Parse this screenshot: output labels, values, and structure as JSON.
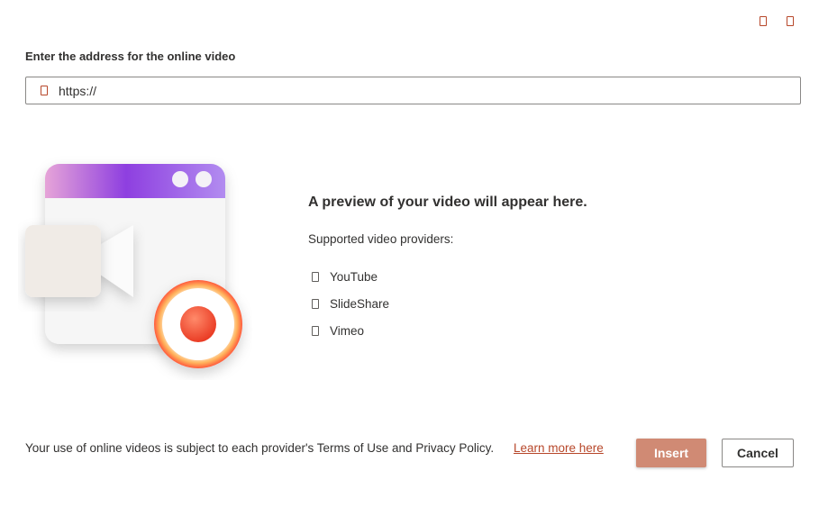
{
  "colors": {
    "accent": "#b7472a",
    "insert_bg": "#d08a74"
  },
  "top_icons": [
    {
      "name": "maximize-icon"
    },
    {
      "name": "close-icon"
    }
  ],
  "url_section": {
    "title": "Enter the address for the online video",
    "icon": "link-icon",
    "value": "https://"
  },
  "preview": {
    "title": "A preview of your video will appear here.",
    "providers_label": "Supported video providers:",
    "providers": [
      {
        "label": "YouTube",
        "icon": "youtube-icon"
      },
      {
        "label": "SlideShare",
        "icon": "slideshare-icon"
      },
      {
        "label": "Vimeo",
        "icon": "vimeo-icon"
      }
    ]
  },
  "footer": {
    "terms_text": "Your use of online videos is subject to each provider's Terms of Use and Privacy Policy.",
    "learn_more": "Learn more here"
  },
  "buttons": {
    "insert": "Insert",
    "cancel": "Cancel"
  }
}
